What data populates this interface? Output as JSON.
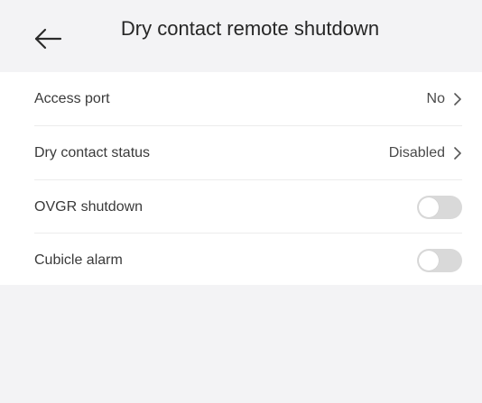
{
  "header": {
    "title": "Dry contact remote shutdown"
  },
  "settings": [
    {
      "label": "Access port",
      "type": "select",
      "value": "No"
    },
    {
      "label": "Dry contact status",
      "type": "select",
      "value": "Disabled"
    },
    {
      "label": "OVGR shutdown",
      "type": "toggle",
      "enabled": false
    },
    {
      "label": "Cubicle alarm",
      "type": "toggle",
      "enabled": false
    }
  ],
  "colors": {
    "page_background": "#f3f3f5",
    "card_background": "#ffffff",
    "toggle_off": "#d9d9d9"
  },
  "icons": {
    "back": "arrow-left-icon",
    "chevron": "chevron-right-icon"
  }
}
